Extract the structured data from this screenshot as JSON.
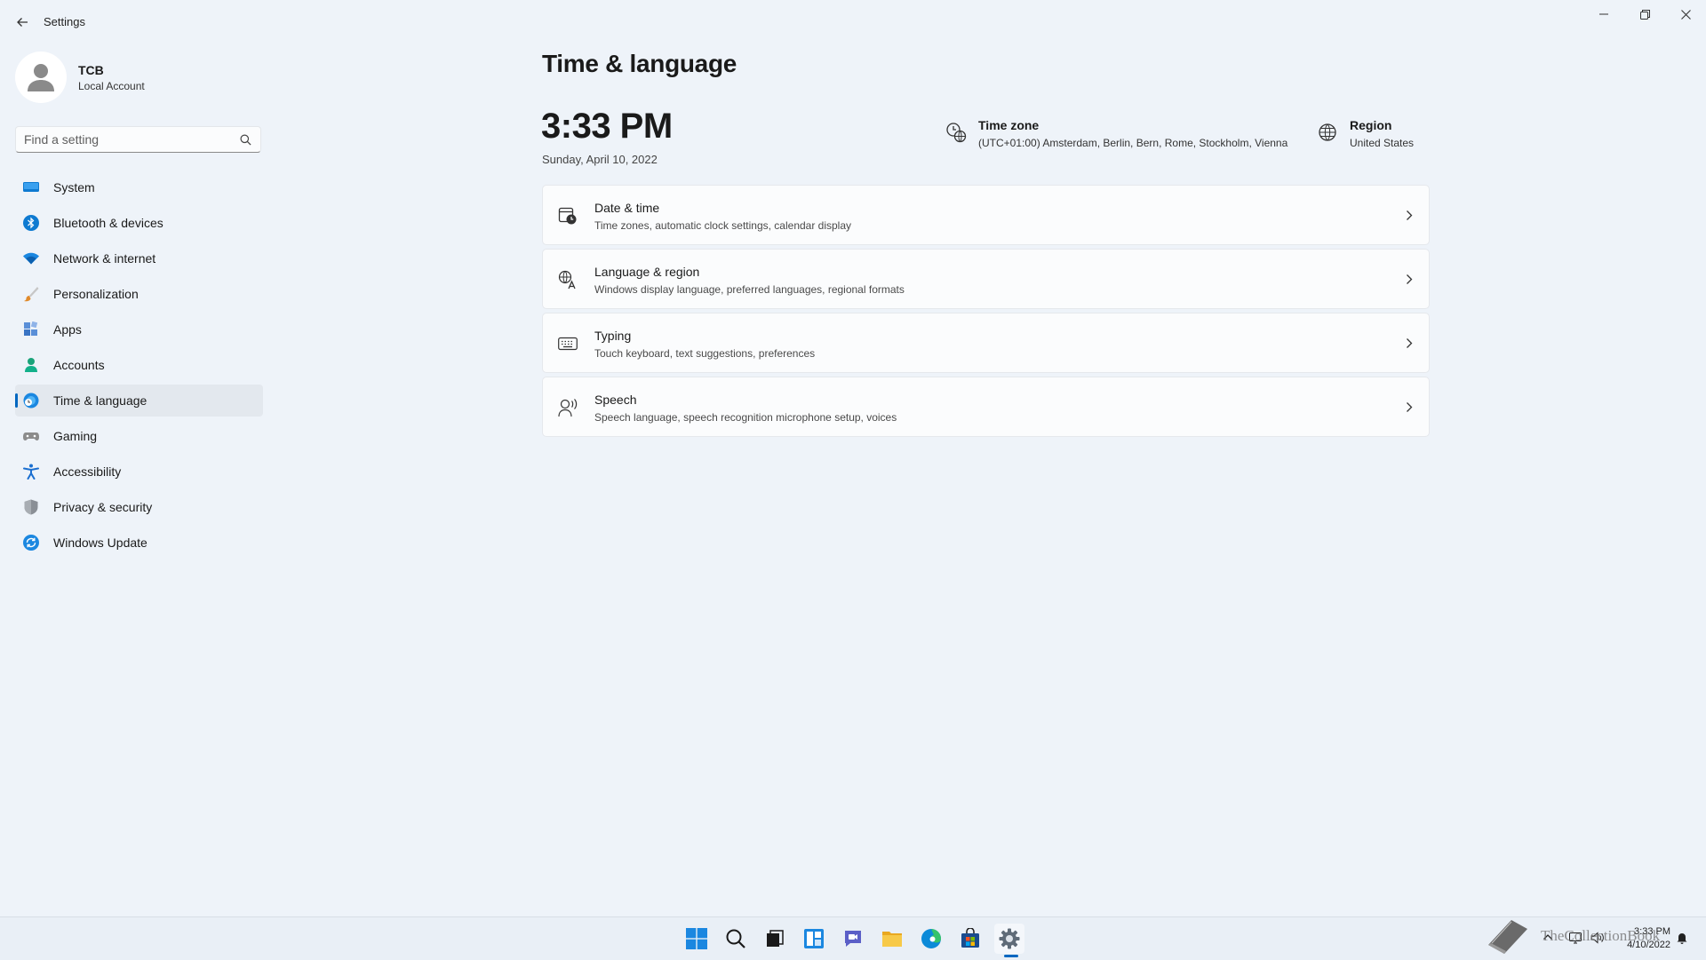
{
  "window": {
    "title": "Settings"
  },
  "profile": {
    "name": "TCB",
    "account_type": "Local Account"
  },
  "search": {
    "placeholder": "Find a setting"
  },
  "sidebar": {
    "items": [
      {
        "label": "System",
        "icon": "monitor-icon"
      },
      {
        "label": "Bluetooth & devices",
        "icon": "bluetooth-icon"
      },
      {
        "label": "Network & internet",
        "icon": "wifi-icon"
      },
      {
        "label": "Personalization",
        "icon": "brush-icon"
      },
      {
        "label": "Apps",
        "icon": "apps-icon"
      },
      {
        "label": "Accounts",
        "icon": "person-icon"
      },
      {
        "label": "Time & language",
        "icon": "globe-clock-icon",
        "selected": true
      },
      {
        "label": "Gaming",
        "icon": "gamepad-icon"
      },
      {
        "label": "Accessibility",
        "icon": "accessibility-icon"
      },
      {
        "label": "Privacy & security",
        "icon": "shield-icon"
      },
      {
        "label": "Windows Update",
        "icon": "update-icon"
      }
    ]
  },
  "main": {
    "title": "Time & language",
    "time": "3:33 PM",
    "date": "Sunday, April 10, 2022",
    "timezone": {
      "title": "Time zone",
      "value": "(UTC+01:00) Amsterdam, Berlin, Bern, Rome, Stockholm, Vienna"
    },
    "region": {
      "title": "Region",
      "value": "United States"
    },
    "cards": [
      {
        "title": "Date & time",
        "subtitle": "Time zones, automatic clock settings, calendar display",
        "icon": "calendar-clock-icon"
      },
      {
        "title": "Language & region",
        "subtitle": "Windows display language, preferred languages, regional formats",
        "icon": "language-icon"
      },
      {
        "title": "Typing",
        "subtitle": "Touch keyboard, text suggestions, preferences",
        "icon": "keyboard-icon"
      },
      {
        "title": "Speech",
        "subtitle": "Speech language, speech recognition microphone setup, voices",
        "icon": "speech-icon"
      }
    ]
  },
  "taskbar": {
    "apps": [
      "start-icon",
      "search-icon",
      "task-view-icon",
      "widgets-icon",
      "chat-icon",
      "file-explorer-icon",
      "edge-icon",
      "store-icon",
      "settings-icon"
    ],
    "active_app": "settings-icon",
    "tray": {
      "time": "3:33 PM",
      "date": "4/10/2022"
    },
    "watermark": "TheCollectionBook"
  },
  "colors": {
    "accent": "#0067c0",
    "background": "#eef3f9",
    "card": "#fbfcfd"
  }
}
